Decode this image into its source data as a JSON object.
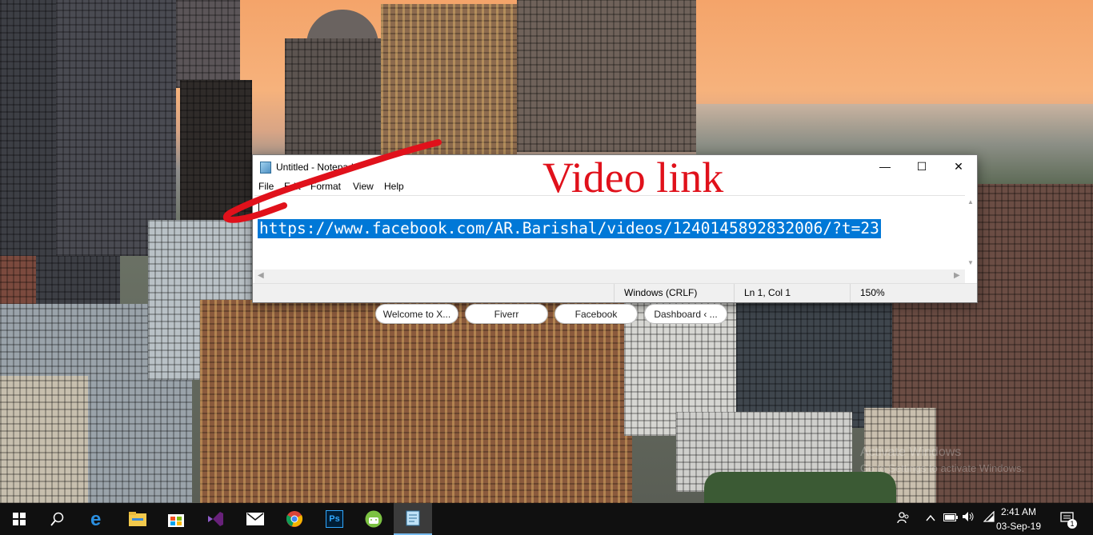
{
  "annotation": {
    "title": "Video link",
    "color": "#e0111b"
  },
  "notepad": {
    "window_title": "Untitled - Notepad",
    "icon": "notepad-icon",
    "controls": {
      "minimize": "—",
      "maximize": "☐",
      "close": "✕"
    },
    "menu": [
      "File",
      "Edit",
      "Format",
      "View",
      "Help"
    ],
    "content": "https://www.facebook.com/AR.Barishal/videos/1240145892832006/?t=23",
    "selection_color": "#0078d7",
    "status": {
      "line_ending": "Windows (CRLF)",
      "position": "Ln 1, Col 1",
      "zoom": "150%"
    }
  },
  "speed_dial": [
    {
      "label": "Welcome to X..."
    },
    {
      "label": "Fiverr"
    },
    {
      "label": "Facebook"
    },
    {
      "label": "Dashboard ‹ ..."
    }
  ],
  "watermark": {
    "line1": "Activate Windows",
    "line2": "Go to Settings to activate Windows."
  },
  "taskbar": {
    "apps": [
      {
        "name": "start-icon"
      },
      {
        "name": "search-icon"
      },
      {
        "name": "edge-icon"
      },
      {
        "name": "file-explorer-icon"
      },
      {
        "name": "store-icon"
      },
      {
        "name": "visual-studio-icon"
      },
      {
        "name": "mail-icon"
      },
      {
        "name": "chrome-icon"
      },
      {
        "name": "photoshop-icon",
        "label": "Ps"
      },
      {
        "name": "android-app-icon"
      },
      {
        "name": "notepad-icon"
      }
    ],
    "clock": {
      "time": "2:41 AM",
      "date": "03-Sep-19"
    },
    "notifications_count": "1"
  }
}
